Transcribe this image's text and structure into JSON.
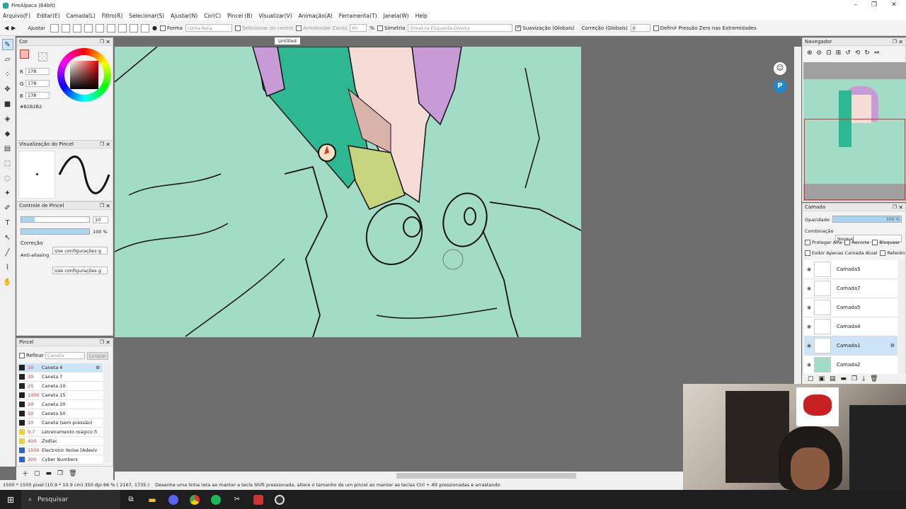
{
  "window": {
    "title": "FireAlpaca (64bit)",
    "controls": [
      "–",
      "❐",
      "✕"
    ]
  },
  "menu": [
    "Arquivo(F)",
    "Editar(E)",
    "Camada(L)",
    "Filtro(R)",
    "Selecionar(S)",
    "Ajustar(N)",
    "Cor(C)",
    "Pincel (B)",
    "Visualizar(V)",
    "Animação(A)",
    "Ferramenta(T)",
    "Janela(W)",
    "Help"
  ],
  "toolbar": {
    "ajustar": "Ajustar",
    "forma": "Forma",
    "forma_value": "Linha Reta",
    "selecionar_centro": "Selecionar do centro",
    "arredondar": "Arredondar Canto",
    "arredondar_value": "80",
    "percent": "%",
    "simetria": "Simetria",
    "simetria_value": "Simetria Esquerda-Direita",
    "suavizacao": "Suavização (Globais)",
    "correcao": "Correção (Globais)",
    "correcao_value": "0",
    "pressao": "Definir Pressão Zero nas Extremidades"
  },
  "color_panel": {
    "title": "Cor",
    "r_label": "R",
    "r": "178",
    "g_label": "G",
    "g": "178",
    "b_label": "B",
    "b": "178",
    "hex": "#B2B2B2",
    "current_color": "#f2b8b8"
  },
  "brush_preview": {
    "title": "Visualização do Pincel"
  },
  "brush_control": {
    "title": "Controle de Pincel",
    "size": "10",
    "opacity": "100 %",
    "correcao_label": "Correção",
    "correcao_value": "Use configurações g",
    "antialias_label": "Anti-aliasing",
    "antialias_value": "Use configurações g"
  },
  "brush_panel": {
    "title": "Pincel",
    "refinar": "Refinar",
    "search_placeholder": "Caneta",
    "limpar": "Limpar",
    "items": [
      {
        "size": "10",
        "name": "Caneta 4",
        "color": "#222222",
        "selected": true
      },
      {
        "size": "30",
        "name": "Caneta 7",
        "color": "#222222"
      },
      {
        "size": "25",
        "name": "Caneta 10",
        "color": "#222222"
      },
      {
        "size": "1000",
        "name": "Caneta 15",
        "color": "#222222"
      },
      {
        "size": "20",
        "name": "Caneta 20",
        "color": "#222222"
      },
      {
        "size": "50",
        "name": "Caneta 50",
        "color": "#222222"
      },
      {
        "size": "10",
        "name": "Caneta (sem pressão)",
        "color": "#222222"
      },
      {
        "size": "0.7",
        "name": "Letreiramento mágico fi",
        "color": "#e8d23a"
      },
      {
        "size": "400",
        "name": "Zodíac",
        "color": "#e8d23a"
      },
      {
        "size": "1500",
        "name": "Electronic Noise [Adesiv",
        "color": "#2f5fd9"
      },
      {
        "size": "300",
        "name": "Cyber Numbers",
        "color": "#2f5fd9"
      }
    ]
  },
  "canvas": {
    "doc_tab": "Untitled"
  },
  "navigator": {
    "title": "Navegador"
  },
  "layer_panel": {
    "title": "Camada",
    "opacity_label": "Opacidade",
    "opacity": "100 %",
    "blend_label": "Combinação",
    "blend": "Normal",
    "protect_alpha": "Proteger Alfa",
    "clip": "Recorte",
    "lock": "Bloquear",
    "show_current": "Exibir Apenas Camada Atual",
    "reference": "Referência",
    "layers": [
      {
        "name": "Camada5",
        "active": false
      },
      {
        "name": "Camada7",
        "active": false
      },
      {
        "name": "Camada5",
        "active": false
      },
      {
        "name": "Camada4",
        "active": false
      },
      {
        "name": "Camada1",
        "active": true
      },
      {
        "name": "Camada2",
        "active": false
      }
    ]
  },
  "status": {
    "doc_size": "1500 * 1500 pixel  (10.9 * 10.9 cm)  350 dpi  66 %  ( 2167, 1735 )",
    "hint": "Desenhe uma linha reta ao manter a tecla Shift pressionada, altere o tamanho de um pincel ao manter as teclas Ctrl + Alt pressionadas e arrastando"
  },
  "taskbar": {
    "search": "Pesquisar"
  }
}
